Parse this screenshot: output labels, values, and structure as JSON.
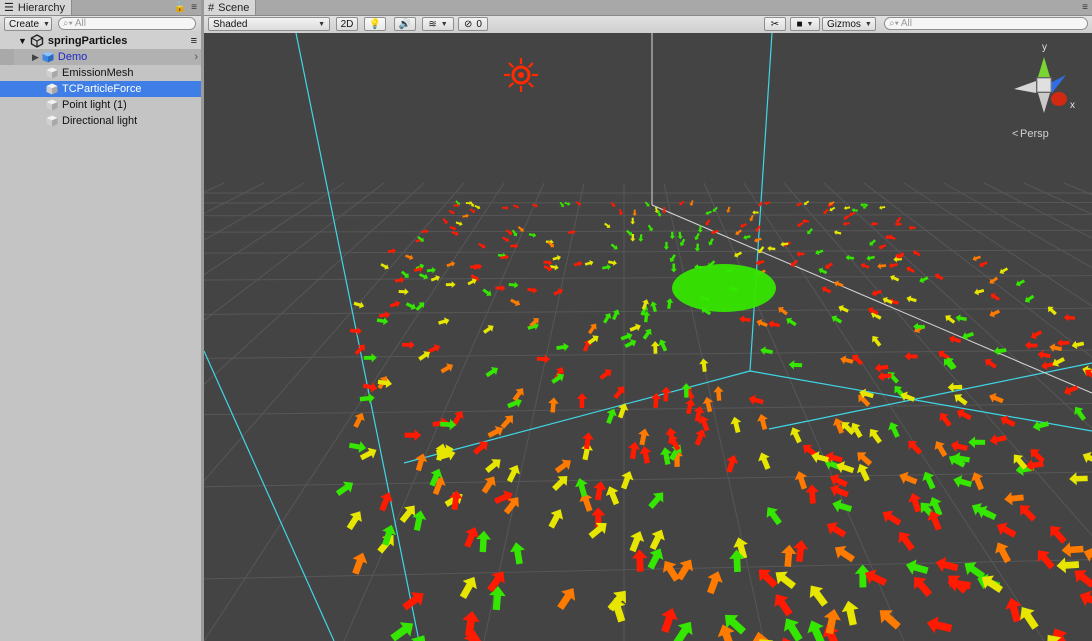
{
  "hierarchy": {
    "tab_label": "Hierarchy",
    "create_label": "Create",
    "search_placeholder": "All",
    "root_label": "springParticles",
    "items": [
      {
        "label": "Demo",
        "type": "prefab",
        "state": "collapsed"
      },
      {
        "label": "EmissionMesh",
        "type": "gameobject"
      },
      {
        "label": "TCParticleForce",
        "type": "gameobject",
        "selected": true
      },
      {
        "label": "Point light (1)",
        "type": "gameobject"
      },
      {
        "label": "Directional light",
        "type": "gameobject"
      }
    ]
  },
  "scene": {
    "tab_label": "Scene",
    "shading_mode": "Shaded",
    "mode_2d_label": "2D",
    "hidden_count": "0",
    "gizmos_label": "Gizmos",
    "search_placeholder": "All",
    "projection_label": "Persp",
    "axis_labels": {
      "y": "y",
      "x": "x"
    }
  },
  "colors": {
    "selection": "#3e7ee6",
    "viewport_bg": "#444444",
    "grid_line": "#575757",
    "bounds_line": "#3fd7e6",
    "particle_red": "#ff1a00",
    "particle_orange": "#ff7a00",
    "particle_yellow": "#e6e600",
    "particle_green": "#35e600",
    "light_gizmo": "#ff2a00"
  }
}
